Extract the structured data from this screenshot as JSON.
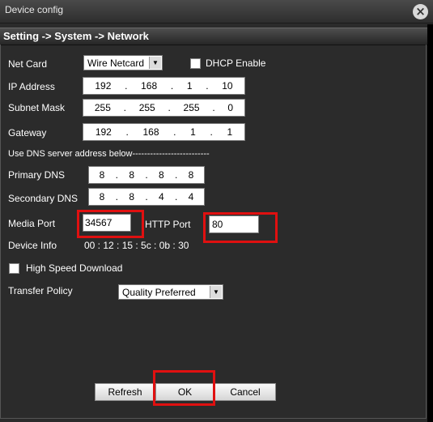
{
  "window": {
    "title": "Device config",
    "close_icon": "close-icon"
  },
  "breadcrumb": "Setting -> System -> Network",
  "net_card": {
    "label": "Net Card",
    "value": "Wire Netcard"
  },
  "dhcp": {
    "label": "DHCP Enable",
    "checked": false
  },
  "ip_address": {
    "label": "IP Address",
    "octets": [
      "192",
      "168",
      "1",
      "10"
    ]
  },
  "subnet_mask": {
    "label": "Subnet Mask",
    "octets": [
      "255",
      "255",
      "255",
      "0"
    ]
  },
  "gateway": {
    "label": "Gateway",
    "octets": [
      "192",
      "168",
      "1",
      "1"
    ]
  },
  "dns_heading": "Use DNS server address below--------------------------",
  "primary_dns": {
    "label": "Primary DNS",
    "octets": [
      "8",
      "8",
      "8",
      "8"
    ]
  },
  "secondary_dns": {
    "label": "Secondary DNS",
    "octets": [
      "8",
      "8",
      "4",
      "4"
    ]
  },
  "media_port": {
    "label": "Media Port",
    "value": "34567"
  },
  "http_port": {
    "label": "HTTP Port",
    "value": "80"
  },
  "device_info": {
    "label": "Device Info",
    "value": "00 : 12 : 15 : 5c : 0b : 30"
  },
  "high_speed": {
    "label": "High Speed Download",
    "checked": false
  },
  "transfer_policy": {
    "label": "Transfer Policy",
    "value": "Quality Preferred"
  },
  "buttons": {
    "refresh": "Refresh",
    "ok": "OK",
    "cancel": "Cancel"
  },
  "colors": {
    "highlight": "#e01010",
    "background": "#2b2b2b"
  }
}
